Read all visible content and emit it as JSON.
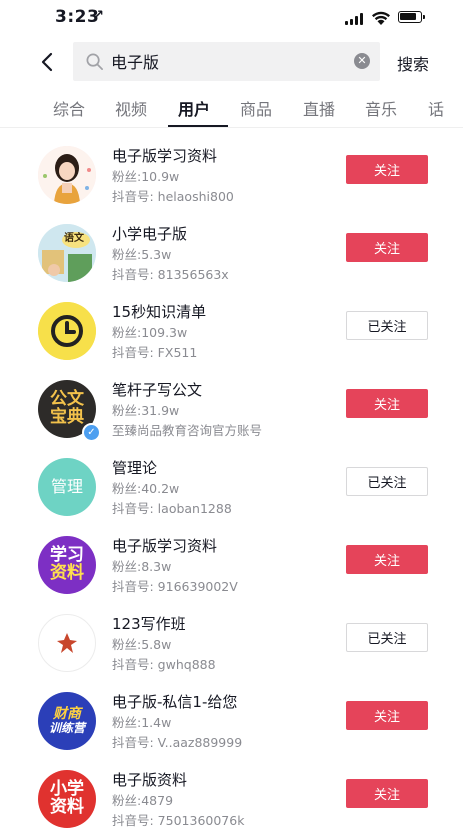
{
  "status_bar": {
    "time": "3:23",
    "location_arrow": "↗"
  },
  "search": {
    "query": "电子版",
    "submit_label": "搜索"
  },
  "tabs": [
    {
      "label": "综合"
    },
    {
      "label": "视频"
    },
    {
      "label": "用户"
    },
    {
      "label": "商品"
    },
    {
      "label": "直播"
    },
    {
      "label": "音乐"
    },
    {
      "label": "话"
    }
  ],
  "active_tab": "用户",
  "users": [
    {
      "name": "电子版学习资料",
      "fans": "粉丝:10.9w",
      "uid": "抖音号: helaoshi800",
      "button": "关注",
      "followed": false
    },
    {
      "name": "小学电子版",
      "fans": "粉丝:5.3w",
      "uid": "抖音号: 81356563x",
      "button": "关注",
      "followed": false
    },
    {
      "name": "15秒知识清单",
      "fans": "粉丝:109.3w",
      "uid": "抖音号: FX511",
      "button": "已关注",
      "followed": true
    },
    {
      "name": "笔杆子写公文",
      "fans": "粉丝:31.9w",
      "uid": "至臻尚品教育咨询官方账号",
      "button": "关注",
      "followed": false,
      "verified": true
    },
    {
      "name": "管理论",
      "fans": "粉丝:40.2w",
      "uid": "抖音号: laoban1288",
      "button": "已关注",
      "followed": true
    },
    {
      "name": "电子版学习资料",
      "fans": "粉丝:8.3w",
      "uid": "抖音号: 916639002V",
      "button": "关注",
      "followed": false
    },
    {
      "name": "123写作班",
      "fans": "粉丝:5.8w",
      "uid": "抖音号: gwhq888",
      "button": "已关注",
      "followed": true
    },
    {
      "name": "电子版-私信1-给您",
      "fans": "粉丝:1.4w",
      "uid": "抖音号: V..aaz889999",
      "button": "关注",
      "followed": false
    },
    {
      "name": "电子版资料",
      "fans": "粉丝:4879",
      "uid": "抖音号: 7501360076k",
      "button": "关注",
      "followed": false
    }
  ],
  "avatars": {
    "a2_text": "语文",
    "a4_line1": "公文",
    "a4_line2": "宝典",
    "a5_text": "管理",
    "a6_line1": "学习",
    "a6_line2": "资料",
    "a8_line1": "财商",
    "a8_line2": "训练营",
    "a9_line1": "小学",
    "a9_line2": "资料"
  },
  "colors": {
    "follow_red": "#e5445a",
    "text_primary": "#161823",
    "text_secondary": "#8a8b91",
    "verified_blue": "#4d9ff0"
  }
}
